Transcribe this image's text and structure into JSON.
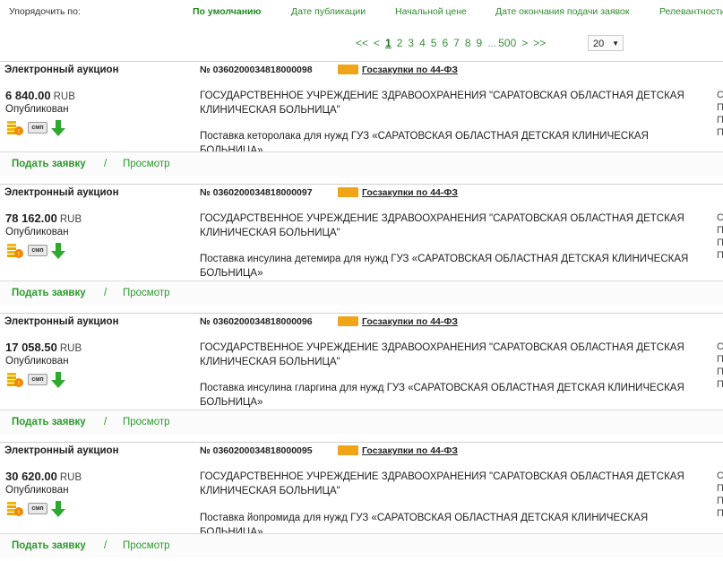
{
  "sort": {
    "label": "Упорядочить по:",
    "options": [
      "По умолчанию",
      "Дате публикации",
      "Начальной цене",
      "Дате окончания подачи заявок",
      "Релевантности"
    ]
  },
  "pager": {
    "first": "<<",
    "prev": "<",
    "pages": [
      "1",
      "2",
      "3",
      "4",
      "5",
      "6",
      "7",
      "8",
      "9"
    ],
    "dots": "...",
    "last_page": "500",
    "next": ">",
    "last": ">>",
    "per_page": "20"
  },
  "colors": {
    "accent": "#2a9a2a",
    "tag": "#f0a417"
  },
  "icons": [
    "coins-icon",
    "smp-badge-icon",
    "download-arrow-icon"
  ],
  "cards": [
    {
      "type": "Электронный аукцион",
      "number": "№ 0360200034818000098",
      "law": "Госзакупки по 44-ФЗ",
      "price": "6 840.00",
      "currency": "RUB",
      "status": "Опубликован",
      "smp": "смп",
      "org_line1": "ГОСУДАРСТВЕННОЕ УЧРЕЖДЕНИЕ ЗДРАВООХРАНЕНИЯ \"САРАТОВСКАЯ ОБЛАСТНАЯ ДЕТСКАЯ",
      "org_line2": "КЛИНИЧЕСКАЯ БОЛЬНИЦА\"",
      "desc_line1": "Поставка кеторолака для нужд ГУЗ «САРАТОВСКАЯ ОБЛАСТНАЯ ДЕТСКАЯ КЛИНИЧЕСКАЯ БОЛЬНИЦА»",
      "desc_line2": "",
      "apply": "Подать заявку",
      "sep": "/",
      "view": "Просмотр"
    },
    {
      "type": "Электронный аукцион",
      "number": "№ 0360200034818000097",
      "law": "Госзакупки по 44-ФЗ",
      "price": "78 162.00",
      "currency": "RUB",
      "status": "Опубликован",
      "smp": "смп",
      "org_line1": "ГОСУДАРСТВЕННОЕ УЧРЕЖДЕНИЕ ЗДРАВООХРАНЕНИЯ \"САРАТОВСКАЯ ОБЛАСТНАЯ ДЕТСКАЯ",
      "org_line2": "КЛИНИЧЕСКАЯ БОЛЬНИЦА\"",
      "desc_line1": "Поставка инсулина детемира для нужд ГУЗ «САРАТОВСКАЯ ОБЛАСТНАЯ ДЕТСКАЯ КЛИНИЧЕСКАЯ",
      "desc_line2": "БОЛЬНИЦА»",
      "apply": "Подать заявку",
      "sep": "/",
      "view": "Просмотр"
    },
    {
      "type": "Электронный аукцион",
      "number": "№ 0360200034818000096",
      "law": "Госзакупки по 44-ФЗ",
      "price": "17 058.50",
      "currency": "RUB",
      "status": "Опубликован",
      "smp": "смп",
      "org_line1": "ГОСУДАРСТВЕННОЕ УЧРЕЖДЕНИЕ ЗДРАВООХРАНЕНИЯ \"САРАТОВСКАЯ ОБЛАСТНАЯ ДЕТСКАЯ",
      "org_line2": "КЛИНИЧЕСКАЯ БОЛЬНИЦА\"",
      "desc_line1": "Поставка инсулина гларгина для нужд ГУЗ «САРАТОВСКАЯ ОБЛАСТНАЯ ДЕТСКАЯ КЛИНИЧЕСКАЯ",
      "desc_line2": "БОЛЬНИЦА»",
      "apply": "Подать заявку",
      "sep": "/",
      "view": "Просмотр"
    },
    {
      "type": "Электронный аукцион",
      "number": "№ 0360200034818000095",
      "law": "Госзакупки по 44-ФЗ",
      "price": "30 620.00",
      "currency": "RUB",
      "status": "Опубликован",
      "smp": "смп",
      "org_line1": "ГОСУДАРСТВЕННОЕ УЧРЕЖДЕНИЕ ЗДРАВООХРАНЕНИЯ \"САРАТОВСКАЯ ОБЛАСТНАЯ ДЕТСКАЯ",
      "org_line2": "КЛИНИЧЕСКАЯ БОЛЬНИЦА\"",
      "desc_line1": "Поставка йопромида для нужд ГУЗ «САРАТОВСКАЯ ОБЛАСТНАЯ ДЕТСКАЯ КЛИНИЧЕСКАЯ БОЛЬНИЦА»",
      "desc_line2": "",
      "apply": "Подать заявку",
      "sep": "/",
      "view": "Просмотр"
    }
  ]
}
